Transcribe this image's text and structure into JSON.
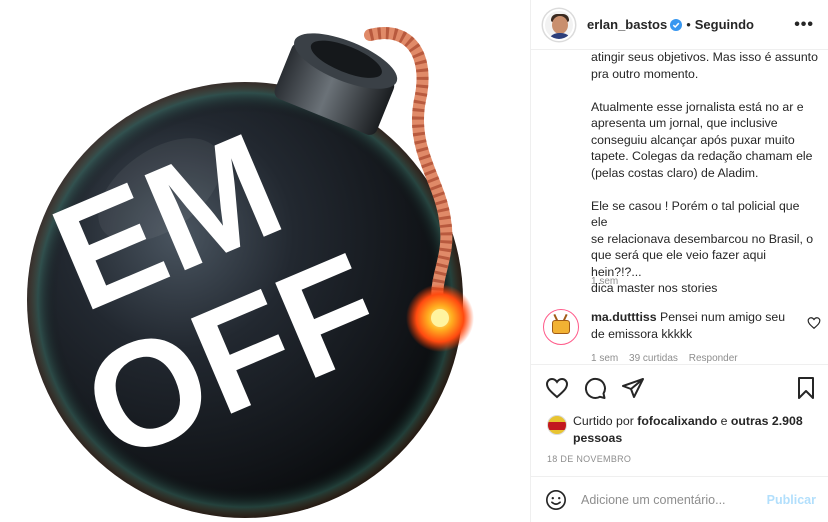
{
  "post": {
    "image": {
      "alt_words": [
        "EM",
        "OFF"
      ],
      "colors": {
        "bomb": "#1b1f24",
        "fuse": "#e08a68",
        "spark": "#ff8a1a",
        "letters": "#ffffff"
      }
    },
    "header": {
      "username": "erlan_bastos",
      "verified": true,
      "separator": "•",
      "follow_status": "Seguindo",
      "more_icon": "more-horizontal-icon"
    },
    "caption": {
      "text": "atingir seus objetivos. Mas isso é assunto\npra outro momento.\n\nAtualmente esse jornalista está no ar e\napresenta um jornal, que inclusive\nconseguiu alcançar após puxar muito\ntapete. Colegas da redação chamam ele\n(pelas costas claro) de Aladim.\n\nEle se casou ! Porém o tal policial que ele\nse relacionava desembarcou no Brasil, o\nque será que ele veio fazer aqui hein?!?...\ndica master nos stories",
      "time": "1 sem"
    },
    "comments": [
      {
        "username": "ma.dutttiss",
        "text": "Pensei num amigo seu de emissora kkkkk",
        "time": "1 sem",
        "likes": "39 curtidas",
        "reply": "Responder"
      }
    ],
    "actions": {
      "icons": [
        "heart-icon",
        "comment-icon",
        "share-icon",
        "save-icon"
      ]
    },
    "likes": {
      "prefix": "Curtido por",
      "user": "fofocalixando",
      "connector": "e",
      "others": "outras 2.908 pessoas"
    },
    "date": "18 DE NOVEMBRO",
    "add_comment": {
      "placeholder": "Adicione um comentário...",
      "publish_label": "Publicar",
      "publish_color": "#b2dffc"
    }
  }
}
